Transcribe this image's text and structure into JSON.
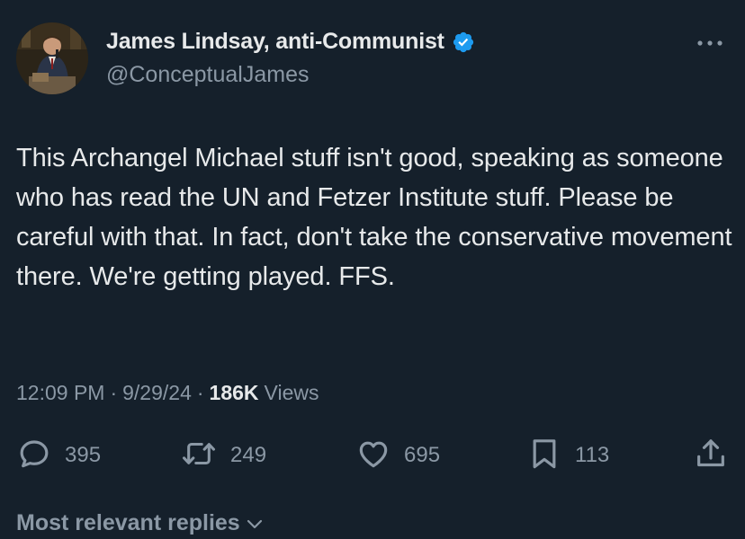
{
  "author": {
    "display_name": "James Lindsay, anti-Communist",
    "handle": "@ConceptualJames",
    "verified_icon": "verified-badge-icon",
    "avatar_icon": "avatar"
  },
  "tweet": {
    "text": "This Archangel Michael stuff isn't good, speaking as someone who has read the UN and Fetzer Institute stuff. Please be careful with that. In fact, don't take the conservative movement there. We're getting played. FFS.",
    "time": "12:09 PM",
    "date": "9/29/24",
    "separator": "·",
    "views_count": "186K",
    "views_label": "Views"
  },
  "actions": {
    "replies": "395",
    "retweets": "249",
    "likes": "695",
    "bookmarks": "113"
  },
  "footer": {
    "replies_sort_label": "Most relevant replies"
  },
  "colors": {
    "background": "#15202b",
    "primary_text": "#e7e9ea",
    "secondary_text": "#8b98a5",
    "verified_blue": "#1d9bf0"
  }
}
